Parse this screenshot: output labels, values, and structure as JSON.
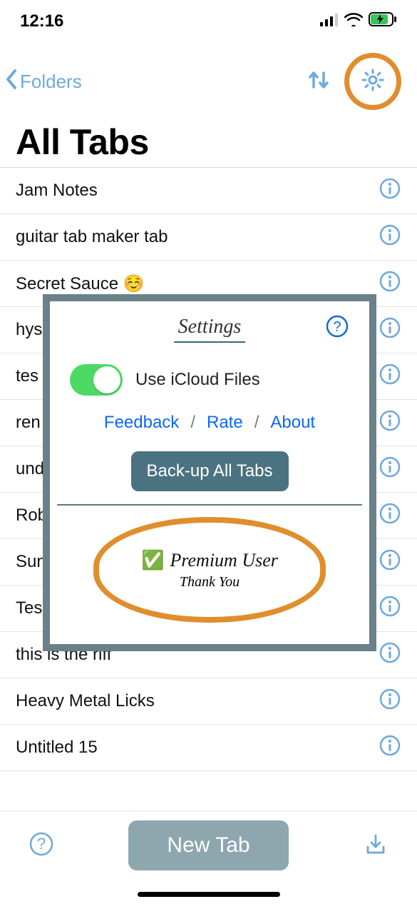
{
  "status": {
    "time": "12:16"
  },
  "nav": {
    "back_label": "Folders"
  },
  "page": {
    "title": "All Tabs"
  },
  "list": {
    "items": [
      {
        "label": "Jam Notes"
      },
      {
        "label": "guitar tab maker tab"
      },
      {
        "label": "Secret Sauce ☺️"
      },
      {
        "label": "hys"
      },
      {
        "label": "tes"
      },
      {
        "label": "ren"
      },
      {
        "label": "und"
      },
      {
        "label": "Rob"
      },
      {
        "label": "Sun"
      },
      {
        "label": "Tes"
      },
      {
        "label": "this is the riff"
      },
      {
        "label": "Heavy Metal Licks"
      },
      {
        "label": "Untitled 15"
      }
    ]
  },
  "bottom": {
    "new_tab": "New Tab"
  },
  "settings": {
    "title": "Settings",
    "icloud_label": "Use iCloud Files",
    "feedback": "Feedback",
    "rate": "Rate",
    "about": "About",
    "backup": "Back-up All Tabs",
    "premium": "Premium User",
    "thank_you": "Thank You"
  }
}
